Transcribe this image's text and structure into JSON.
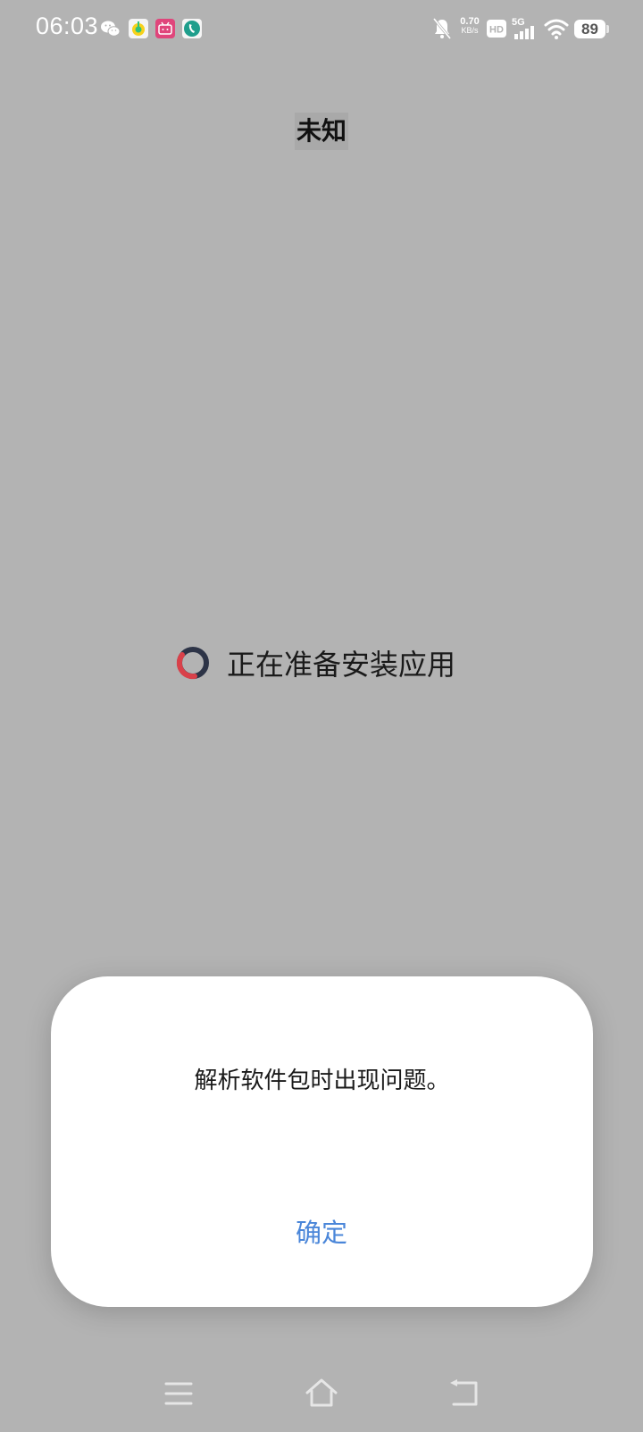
{
  "status_bar": {
    "time": "06:03",
    "notification_icons": [
      "wechat-icon",
      "qq-music-icon",
      "bilibili-icon",
      "phone-app-icon"
    ],
    "net_speed_value": "0.70",
    "net_speed_unit": "KB/s",
    "hd_label": "HD",
    "network_label": "5G",
    "battery_level": "89"
  },
  "page": {
    "title": "未知",
    "progress_text": "正在准备安装应用"
  },
  "dialog": {
    "message": "解析软件包时出现问题。",
    "confirm_label": "确定"
  },
  "colors": {
    "background_scrim": "#b3b3b3",
    "dialog_bg": "#ffffff",
    "accent": "#4a86d9",
    "spinner_dark": "#2d3447",
    "spinner_red": "#d9414a"
  },
  "nav_bar": {
    "icons": [
      "menu-icon",
      "home-icon",
      "back-icon"
    ]
  }
}
